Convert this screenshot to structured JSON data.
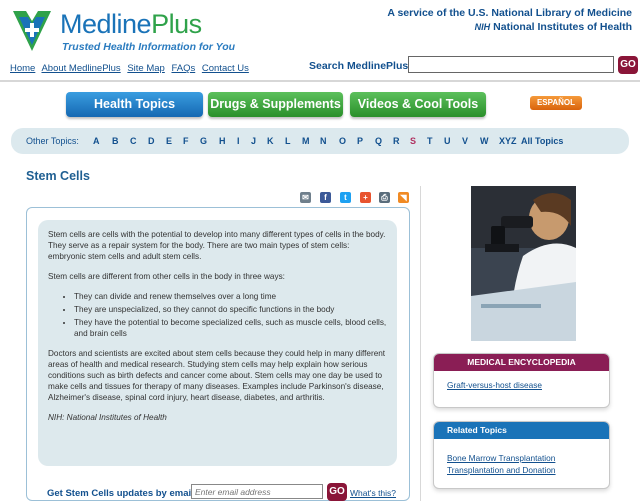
{
  "header": {
    "logo_name": "Medline",
    "logo_plus": "Plus",
    "tagline": "Trusted Health Information for You",
    "service_line1": "A service of the U.S. National Library of Medicine",
    "service_nih": "NIH",
    "service_line2": "National Institutes of Health"
  },
  "toplinks": [
    "Home",
    "About MedlinePlus",
    "Site Map",
    "FAQs",
    "Contact Us"
  ],
  "search": {
    "label": "Search MedlinePlus",
    "value": "",
    "go": "GO"
  },
  "tabs": [
    "Health Topics",
    "Drugs & Supplements",
    "Videos & Cool Tools"
  ],
  "espanol": "ESPAÑOL",
  "other_topics": {
    "label": "Other Topics:",
    "letters": [
      "A",
      "B",
      "C",
      "D",
      "E",
      "F",
      "G",
      "H",
      "I",
      "J",
      "K",
      "L",
      "M",
      "N",
      "O",
      "P",
      "Q",
      "R",
      "S",
      "T",
      "U",
      "V",
      "W",
      "XYZ",
      "All Topics"
    ],
    "selected": "S"
  },
  "page_title": "Stem Cells",
  "share_icons": [
    "email-icon",
    "facebook-icon",
    "twitter-icon",
    "share-plus-icon",
    "print-icon",
    "rss-icon"
  ],
  "summary": {
    "p1": "Stem cells are cells with the potential to develop into many different types of cells in the body. They serve as a repair system for the body. There are two main types of stem cells: embryonic stem cells and adult stem cells.",
    "p2": "Stem cells are different from other cells in the body in three ways:",
    "bullets": [
      "They can divide and renew themselves over a long time",
      "They are unspecialized, so they cannot do specific functions in the body",
      "They have the potential to become specialized cells, such as muscle cells, blood cells, and brain cells"
    ],
    "p3": "Doctors and scientists are excited about stem cells because they could help in many different areas of health and medical research. Studying stem cells may help explain how serious conditions such as birth defects and cancer come about. Stem cells may one day be used to make cells and tissues for therapy of many diseases. Examples include Parkinson's disease, Alzheimer's disease, spinal cord injury, heart disease, diabetes, and arthritis.",
    "source": "NIH: National Institutes of Health"
  },
  "updates": {
    "label": "Get Stem Cells updates by email",
    "placeholder": "Enter email address",
    "go": "GO",
    "whats_this": "What's this?"
  },
  "encyclopedia": {
    "title": "MEDICAL ENCYCLOPEDIA",
    "links": [
      "Graft-versus-host disease"
    ]
  },
  "related": {
    "title": "Related Topics",
    "links": [
      "Bone Marrow Transplantation",
      "Transplantation and Donation"
    ]
  },
  "colors": {
    "brand_blue": "#1a73b8",
    "brand_green": "#2fa24a",
    "go_maroon": "#8a1538",
    "encyclopedia_head": "#8a1e55",
    "summary_bg": "#dde9ed"
  }
}
